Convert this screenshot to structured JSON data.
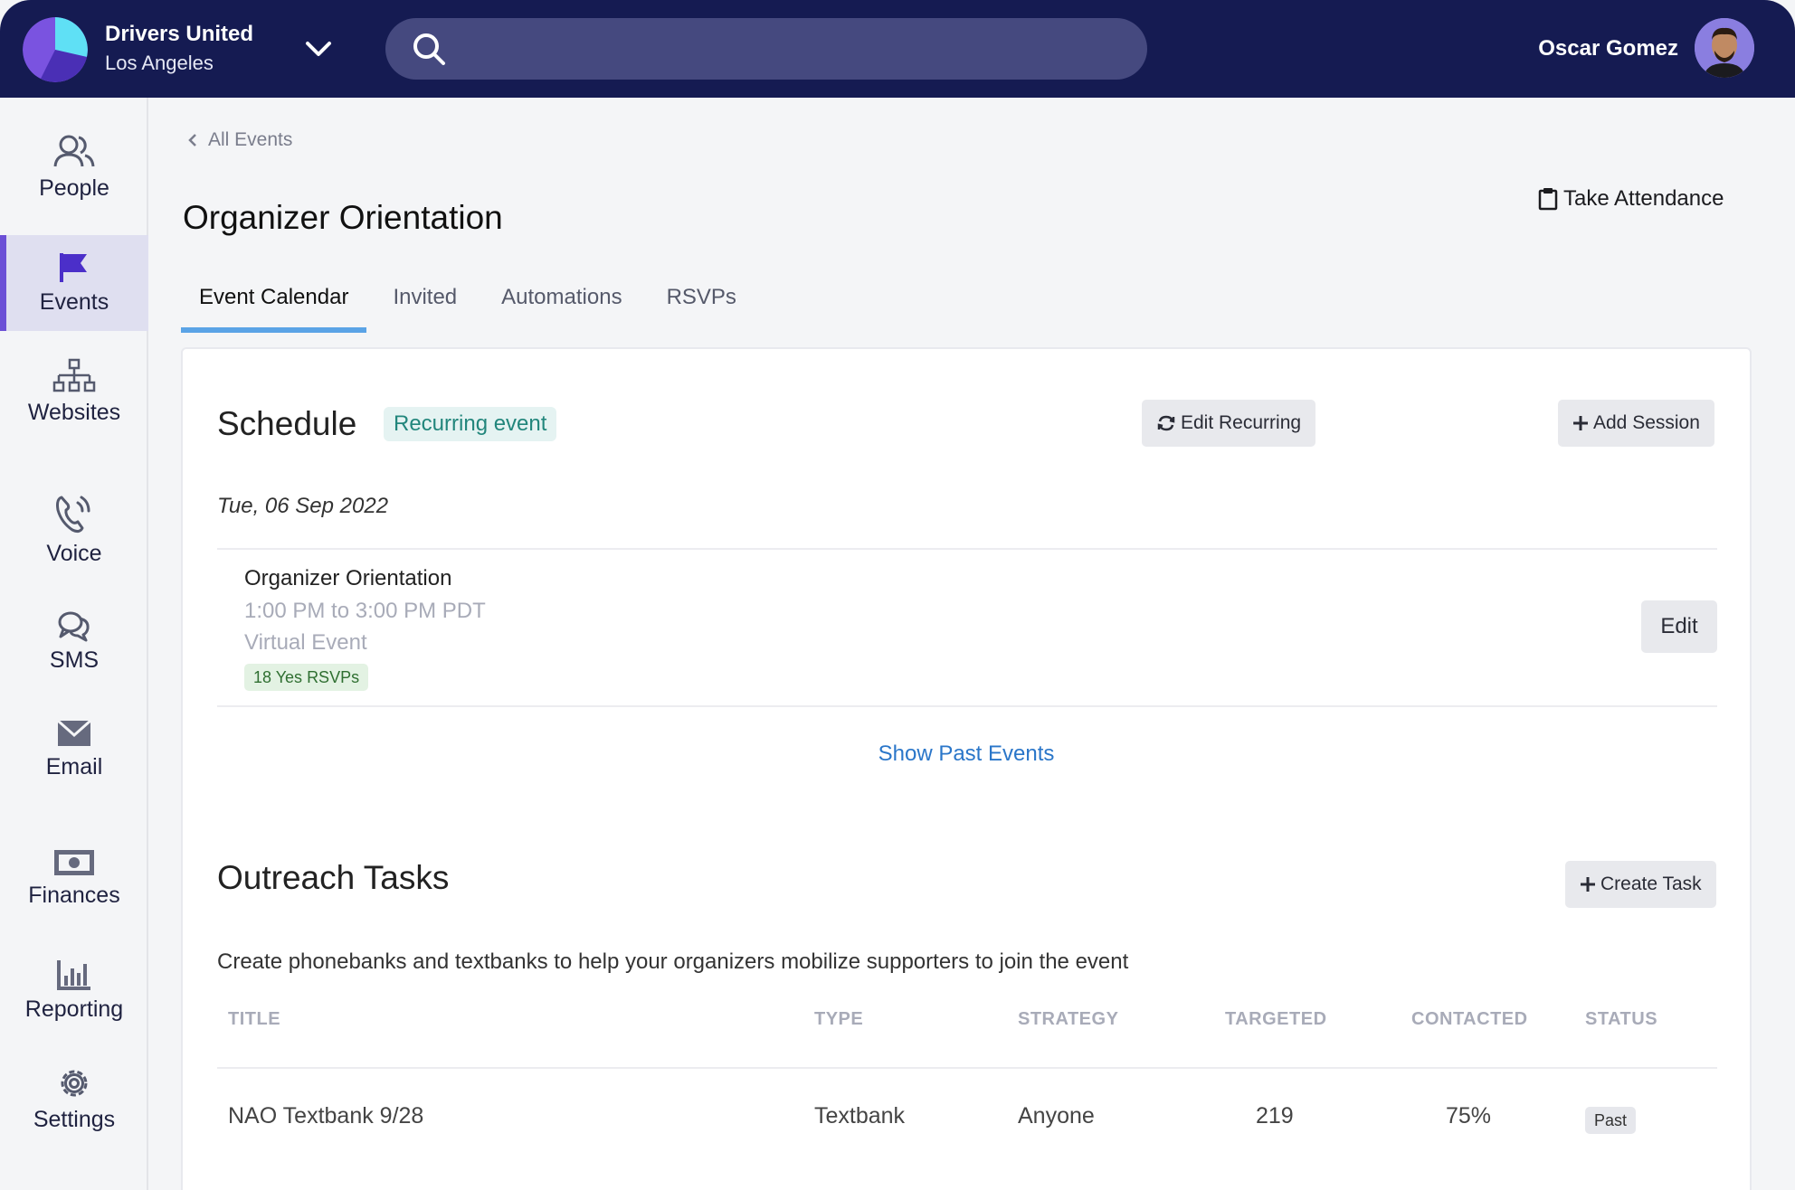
{
  "header": {
    "org_name": "Drivers United",
    "org_location": "Los Angeles",
    "search_placeholder": "",
    "user_name": "Oscar Gomez"
  },
  "sidebar": {
    "items": [
      {
        "label": "People",
        "icon": "people-icon",
        "active": false
      },
      {
        "label": "Events",
        "icon": "flag-icon",
        "active": true
      },
      {
        "label": "Websites",
        "icon": "sitemap-icon",
        "active": false
      },
      {
        "label": "Voice",
        "icon": "phone-icon",
        "active": false
      },
      {
        "label": "SMS",
        "icon": "chat-bubbles-icon",
        "active": false
      },
      {
        "label": "Email",
        "icon": "envelope-icon",
        "active": false
      },
      {
        "label": "Finances",
        "icon": "money-icon",
        "active": false
      },
      {
        "label": "Reporting",
        "icon": "bar-chart-icon",
        "active": false
      },
      {
        "label": "Settings",
        "icon": "gear-icon",
        "active": false
      }
    ]
  },
  "page": {
    "breadcrumb": "All Events",
    "title": "Organizer Orientation",
    "take_attendance": "Take Attendance",
    "tabs": [
      "Event Calendar",
      "Invited",
      "Automations",
      "RSVPs"
    ],
    "active_tab": "Event Calendar"
  },
  "schedule": {
    "title": "Schedule",
    "badge": "Recurring event",
    "edit_recurring": "Edit Recurring",
    "add_session": "Add Session",
    "date": "Tue, 06 Sep 2022",
    "session": {
      "name": "Organizer Orientation",
      "time": "1:00 PM to 3:00 PM PDT",
      "location": "Virtual Event",
      "rsvps": "18 Yes RSVPs",
      "edit": "Edit"
    },
    "show_past": "Show Past Events"
  },
  "outreach": {
    "title": "Outreach Tasks",
    "create_task": "Create Task",
    "description": "Create phonebanks and textbanks to help your organizers mobilize supporters to join the event",
    "columns": [
      "TITLE",
      "TYPE",
      "STRATEGY",
      "TARGETED",
      "CONTACTED",
      "STATUS"
    ],
    "rows": [
      {
        "title": "NAO Textbank 9/28",
        "type": "Textbank",
        "strategy": "Anyone",
        "targeted": "219",
        "contacted": "75%",
        "status": "Past"
      }
    ]
  },
  "colors": {
    "topbar": "#151b52",
    "accent": "#6b4fd6",
    "tab_underline": "#5aa3e6",
    "link": "#2a76c9"
  }
}
